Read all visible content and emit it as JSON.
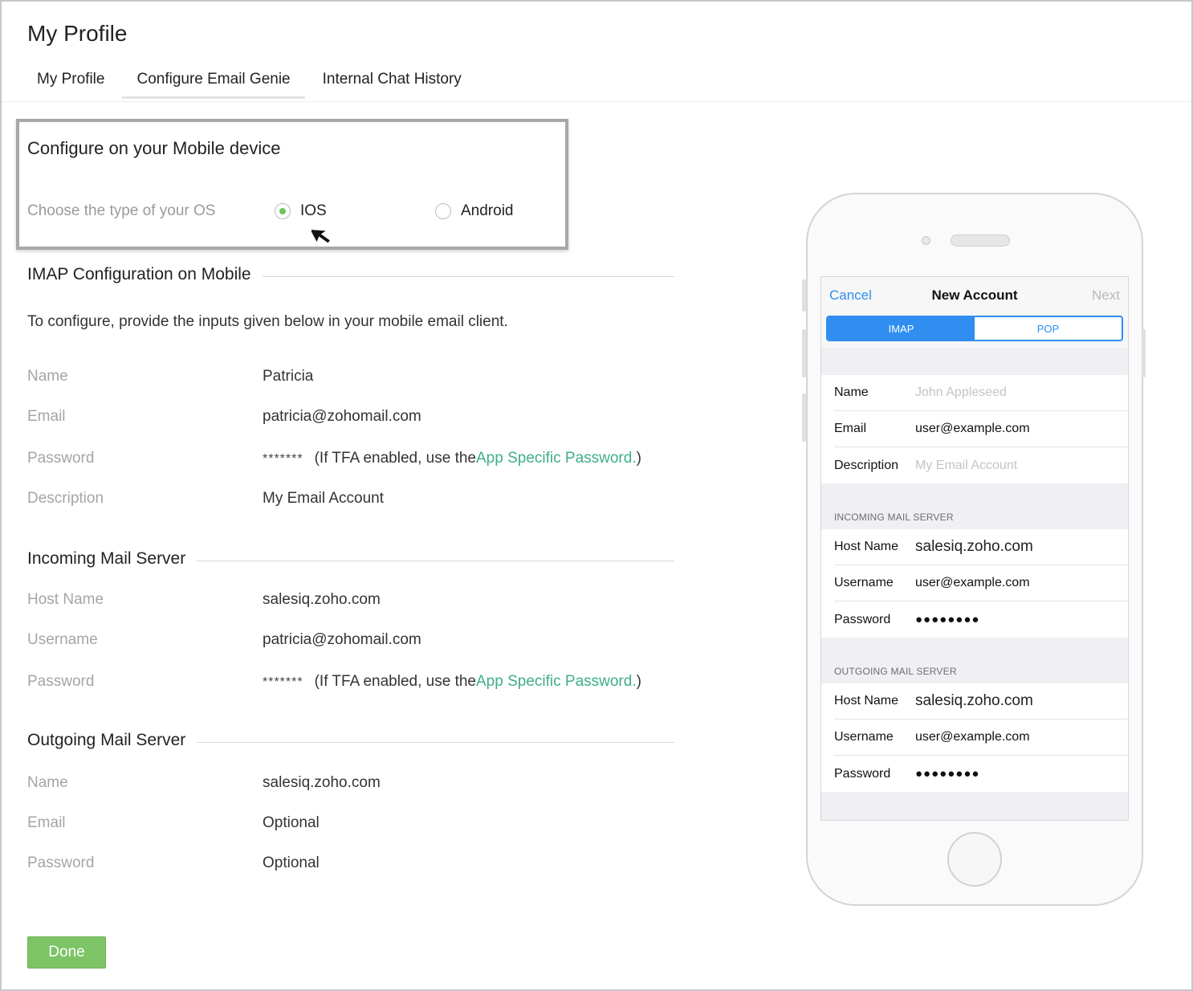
{
  "header": {
    "title": "My Profile"
  },
  "tabs": [
    {
      "label": "My Profile",
      "active": false
    },
    {
      "label": "Configure Email Genie",
      "active": true
    },
    {
      "label": "Internal Chat History",
      "active": false
    }
  ],
  "os_select": {
    "title": "Configure on your Mobile device",
    "label": "Choose the type of your OS",
    "options": [
      {
        "label": "IOS",
        "selected": true
      },
      {
        "label": "Android",
        "selected": false
      }
    ]
  },
  "imap": {
    "heading": "IMAP Configuration on Mobile",
    "intro": "To configure, provide the inputs given below in your mobile email client.",
    "rows": [
      {
        "label": "Name",
        "value": "Patricia"
      },
      {
        "label": "Email",
        "value": "patricia@zohomail.com"
      },
      {
        "label": "Password",
        "stars": "*******",
        "note_pre": "(If TFA enabled, use the ",
        "link": "App Specific Password.",
        "note_post": ")"
      },
      {
        "label": "Description",
        "value": "My Email Account"
      }
    ]
  },
  "incoming": {
    "heading": "Incoming Mail Server",
    "rows": [
      {
        "label": "Host Name",
        "value": "salesiq.zoho.com"
      },
      {
        "label": "Username",
        "value": "patricia@zohomail.com"
      },
      {
        "label": "Password",
        "stars": "*******",
        "note_pre": "(If TFA enabled, use the ",
        "link": "App Specific Password.",
        "note_post": ")"
      }
    ]
  },
  "outgoing": {
    "heading": "Outgoing Mail Server",
    "rows": [
      {
        "label": "Name",
        "value": "salesiq.zoho.com"
      },
      {
        "label": "Email",
        "value": "Optional"
      },
      {
        "label": "Password",
        "value": "Optional"
      }
    ]
  },
  "done_label": "Done",
  "phone": {
    "nav": {
      "cancel": "Cancel",
      "title": "New Account",
      "next": "Next"
    },
    "segments": [
      "IMAP",
      "POP"
    ],
    "account": [
      {
        "label": "Name",
        "value": "John Appleseed"
      },
      {
        "label": "Email",
        "value": "user@example.com"
      },
      {
        "label": "Description",
        "value": "My Email Account"
      }
    ],
    "incoming_caption": "INCOMING MAIL SERVER",
    "incoming": [
      {
        "label": "Host Name",
        "value": "salesiq.zoho.com"
      },
      {
        "label": "Username",
        "value": "user@example.com"
      },
      {
        "label": "Password",
        "value": "●●●●●●●●"
      }
    ],
    "outgoing_caption": "OUTGOING MAIL SERVER",
    "outgoing": [
      {
        "label": "Host Name",
        "value": "salesiq.zoho.com"
      },
      {
        "label": "Username",
        "value": "user@example.com"
      },
      {
        "label": "Password",
        "value": "●●●●●●●●"
      }
    ]
  },
  "colors": {
    "accent_green": "#6fc55a",
    "link_green": "#3fae86",
    "ios_blue": "#2f8ef0",
    "done_button": "#7cc465"
  }
}
